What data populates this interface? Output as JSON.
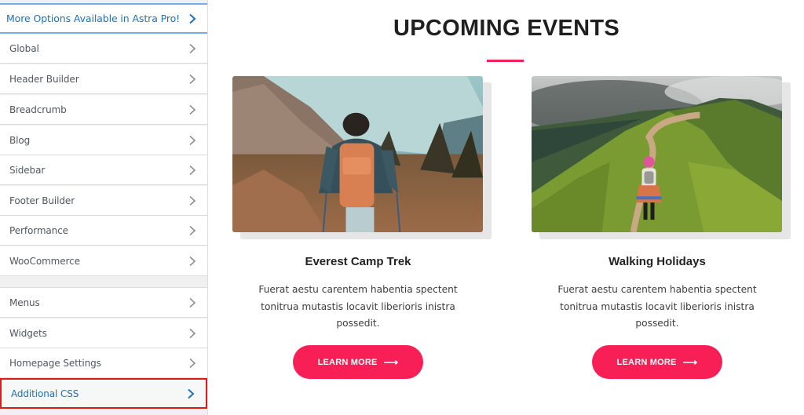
{
  "sidebar": {
    "promo": {
      "label": "More Options Available in Astra Pro!",
      "icon": "chevron-right-icon"
    },
    "items": [
      {
        "label": "Global"
      },
      {
        "label": "Header Builder"
      },
      {
        "label": "Breadcrumb"
      },
      {
        "label": "Blog"
      },
      {
        "label": "Sidebar"
      },
      {
        "label": "Footer Builder"
      },
      {
        "label": "Performance"
      },
      {
        "label": "WooCommerce"
      }
    ],
    "secondary_items": [
      {
        "label": "Menus"
      },
      {
        "label": "Widgets"
      },
      {
        "label": "Homepage Settings"
      },
      {
        "label": "Additional CSS",
        "active": true
      }
    ]
  },
  "main": {
    "section_title": "UPCOMING EVENTS",
    "accent_color": "#f71f56",
    "cards": [
      {
        "title": "Everest Camp Trek",
        "description": "Fuerat aestu carentem habentia spectent tonitrua mutastis locavit liberioris inistra possedit.",
        "button_label": "LEARN MORE",
        "button_icon": "arrow-right-icon",
        "image": "hiker-with-backpack-mountains"
      },
      {
        "title": "Walking Holidays",
        "description": "Fuerat aestu carentem habentia spectent tonitrua mutastis locavit liberioris inistra possedit.",
        "button_label": "LEARN MORE",
        "button_icon": "arrow-right-icon",
        "image": "woman-walking-ridge-trail"
      }
    ]
  }
}
